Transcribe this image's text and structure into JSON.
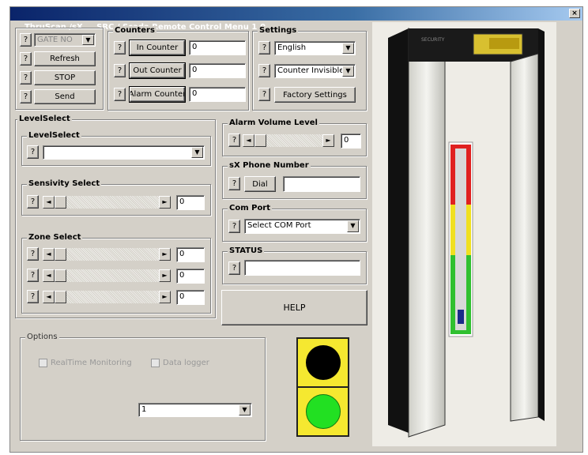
{
  "window": {
    "title": "ThruScan /sX     SRC / Scada Remote Control Menu 1.0",
    "close_glyph": "×"
  },
  "help_glyph": "?",
  "left_controls": {
    "gate_select": "GATE NO",
    "refresh_label": "Refresh",
    "stop_label": "STOP",
    "send_label": "Send"
  },
  "counters": {
    "title": "Counters",
    "in_label": "In Counter",
    "in_value": "0",
    "out_label": "Out Counter",
    "out_value": "0",
    "alarm_label": "Alarm Counter",
    "alarm_value": "0"
  },
  "settings": {
    "title": "Settings",
    "language": "English",
    "counter_visibility": "Counter Invisible",
    "factory_label": "Factory Settings"
  },
  "level_select": {
    "outer_title": "LevelSelect",
    "inner_title": "LevelSelect",
    "value": ""
  },
  "sensitivity": {
    "title": "Sensivity Select",
    "value": "0"
  },
  "zone_select": {
    "title": "Zone Select",
    "values": [
      "0",
      "0",
      "0"
    ]
  },
  "alarm_volume": {
    "title": "Alarm Volume Level",
    "value": "0"
  },
  "phone": {
    "title": "sX Phone Number",
    "dial_label": "Dial",
    "value": ""
  },
  "com_port": {
    "title": "Com Port",
    "value": "Select COM Port"
  },
  "status": {
    "title": "STATUS",
    "value": ""
  },
  "help_label": "HELP",
  "options": {
    "title": "Options",
    "realtime_label": "RealTime Monitoring",
    "datalogger_label": "Data logger",
    "dropdown_value": "1"
  },
  "arrows": {
    "left": "◄",
    "right": "►",
    "down": "▼"
  },
  "device_panel": {
    "brand_text": "SECURITY",
    "display_text": "0 0 1 1"
  },
  "colors": {
    "signal_red": "#000000",
    "signal_green": "#22e022",
    "signal_bg": "#f5e830",
    "meter_red": "#e02020",
    "meter_yellow": "#f0e020",
    "meter_green": "#30c030",
    "level_pointer": "#1a2a8a"
  }
}
